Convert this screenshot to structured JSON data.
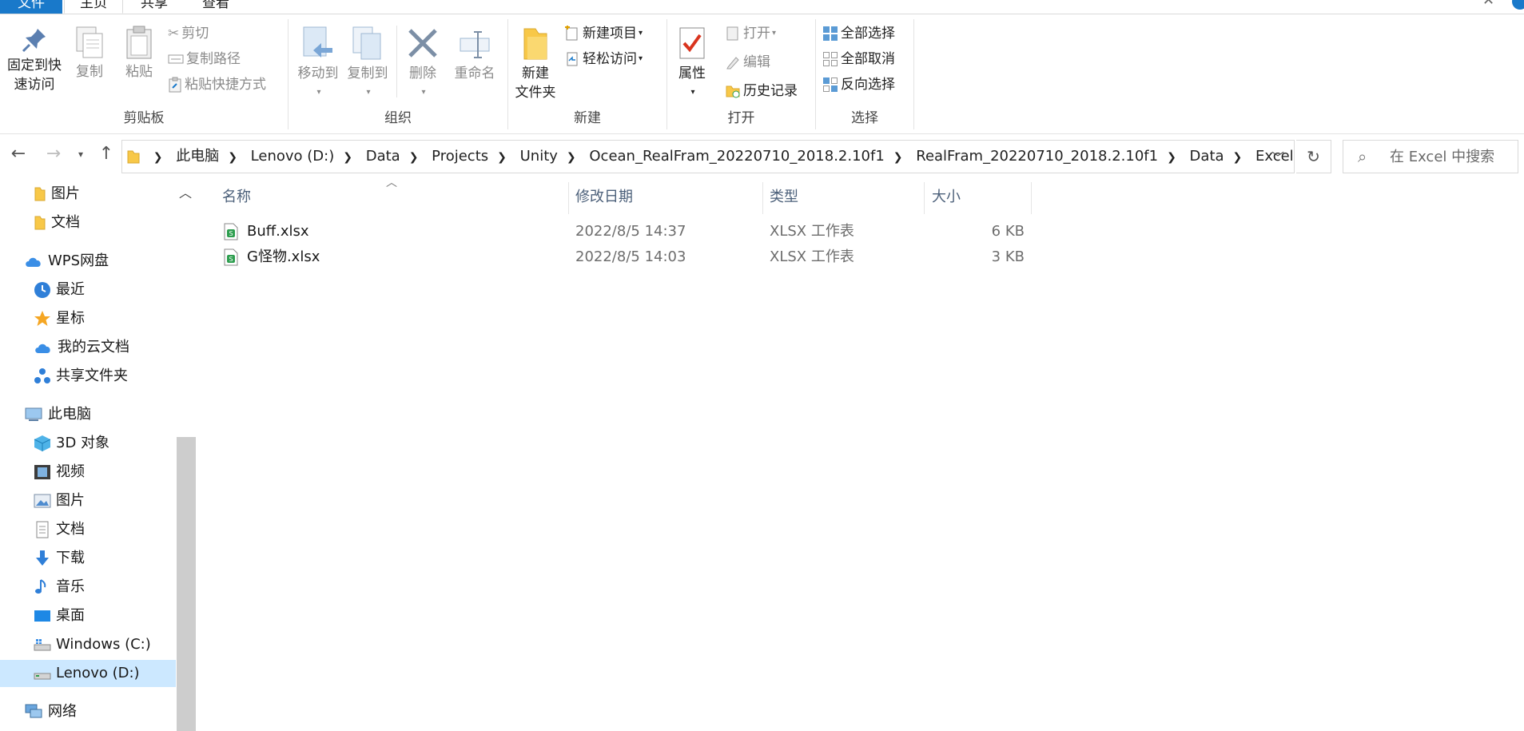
{
  "menu": {
    "tabs": [
      {
        "label": "文件"
      },
      {
        "label": "主页"
      },
      {
        "label": "共享"
      },
      {
        "label": "查看"
      }
    ]
  },
  "ribbon": {
    "clipboard": {
      "label": "剪贴板",
      "pin_line1": "固定到快",
      "pin_line2": "速访问",
      "copy": "复制",
      "paste": "粘贴",
      "cut": "剪切",
      "copy_path": "复制路径",
      "paste_shortcut": "粘贴快捷方式"
    },
    "organize": {
      "label": "组织",
      "move_to": "移动到",
      "copy_to": "复制到",
      "delete": "删除",
      "rename": "重命名"
    },
    "new": {
      "label": "新建",
      "new_folder_line1": "新建",
      "new_folder_line2": "文件夹",
      "new_item": "新建项目",
      "easy_access": "轻松访问"
    },
    "open": {
      "label": "打开",
      "properties": "属性",
      "open": "打开",
      "edit": "编辑",
      "history": "历史记录"
    },
    "select": {
      "label": "选择",
      "select_all": "全部选择",
      "select_none": "全部取消",
      "invert": "反向选择"
    }
  },
  "address": {
    "crumbs": [
      "此电脑",
      "Lenovo (D:)",
      "Data",
      "Projects",
      "Unity",
      "Ocean_RealFram_20220710_2018.2.10f1",
      "RealFram_20220710_2018.2.10f1",
      "Data",
      "Excel"
    ]
  },
  "search": {
    "placeholder": "在 Excel 中搜索"
  },
  "nav": {
    "items": [
      {
        "label": "图片",
        "icon": "folder-icon"
      },
      {
        "label": "文档",
        "icon": "folder-icon"
      },
      {
        "label": "WPS网盘",
        "icon": "cloud-icon"
      },
      {
        "label": "最近",
        "icon": "clock-icon"
      },
      {
        "label": "星标",
        "icon": "star-icon"
      },
      {
        "label": "我的云文档",
        "icon": "cloud-icon"
      },
      {
        "label": "共享文件夹",
        "icon": "share-icon"
      },
      {
        "label": "此电脑",
        "icon": "computer-icon"
      },
      {
        "label": "3D 对象",
        "icon": "cube-icon"
      },
      {
        "label": "视频",
        "icon": "film-icon"
      },
      {
        "label": "图片",
        "icon": "picture-icon"
      },
      {
        "label": "文档",
        "icon": "document-icon"
      },
      {
        "label": "下载",
        "icon": "download-icon"
      },
      {
        "label": "音乐",
        "icon": "music-icon"
      },
      {
        "label": "桌面",
        "icon": "desktop-icon"
      },
      {
        "label": "Windows (C:)",
        "icon": "drive-icon"
      },
      {
        "label": "Lenovo (D:)",
        "icon": "drive-icon"
      },
      {
        "label": "网络",
        "icon": "network-icon"
      }
    ],
    "selected": "Lenovo (D:)"
  },
  "files": {
    "columns": {
      "name": "名称",
      "modified": "修改日期",
      "type": "类型",
      "size": "大小"
    },
    "rows": [
      {
        "name": "Buff.xlsx",
        "modified": "2022/8/5 14:37",
        "type": "XLSX 工作表",
        "size": "6 KB"
      },
      {
        "name": "G怪物.xlsx",
        "modified": "2022/8/5 14:03",
        "type": "XLSX 工作表",
        "size": "3 KB"
      }
    ]
  },
  "colors": {
    "accent": "#1979ca",
    "selection": "#cce8ff",
    "folder": "#f8c848",
    "xlsx_green": "#2e9e4f"
  }
}
